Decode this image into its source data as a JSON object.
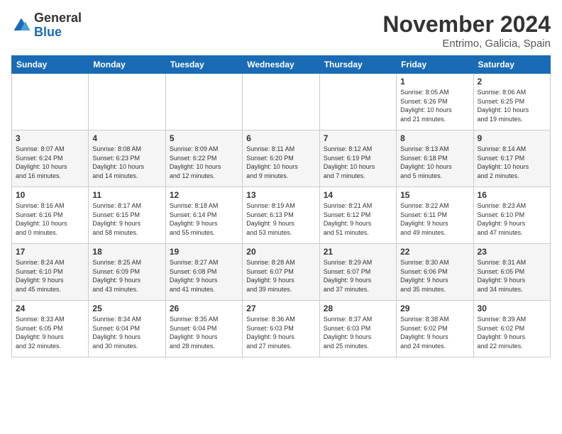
{
  "header": {
    "logo_general": "General",
    "logo_blue": "Blue",
    "month_title": "November 2024",
    "location": "Entrimo, Galicia, Spain"
  },
  "weekdays": [
    "Sunday",
    "Monday",
    "Tuesday",
    "Wednesday",
    "Thursday",
    "Friday",
    "Saturday"
  ],
  "weeks": [
    [
      {
        "day": "",
        "info": ""
      },
      {
        "day": "",
        "info": ""
      },
      {
        "day": "",
        "info": ""
      },
      {
        "day": "",
        "info": ""
      },
      {
        "day": "",
        "info": ""
      },
      {
        "day": "1",
        "info": "Sunrise: 8:05 AM\nSunset: 6:26 PM\nDaylight: 10 hours\nand 21 minutes."
      },
      {
        "day": "2",
        "info": "Sunrise: 8:06 AM\nSunset: 6:25 PM\nDaylight: 10 hours\nand 19 minutes."
      }
    ],
    [
      {
        "day": "3",
        "info": "Sunrise: 8:07 AM\nSunset: 6:24 PM\nDaylight: 10 hours\nand 16 minutes."
      },
      {
        "day": "4",
        "info": "Sunrise: 8:08 AM\nSunset: 6:23 PM\nDaylight: 10 hours\nand 14 minutes."
      },
      {
        "day": "5",
        "info": "Sunrise: 8:09 AM\nSunset: 6:22 PM\nDaylight: 10 hours\nand 12 minutes."
      },
      {
        "day": "6",
        "info": "Sunrise: 8:11 AM\nSunset: 6:20 PM\nDaylight: 10 hours\nand 9 minutes."
      },
      {
        "day": "7",
        "info": "Sunrise: 8:12 AM\nSunset: 6:19 PM\nDaylight: 10 hours\nand 7 minutes."
      },
      {
        "day": "8",
        "info": "Sunrise: 8:13 AM\nSunset: 6:18 PM\nDaylight: 10 hours\nand 5 minutes."
      },
      {
        "day": "9",
        "info": "Sunrise: 8:14 AM\nSunset: 6:17 PM\nDaylight: 10 hours\nand 2 minutes."
      }
    ],
    [
      {
        "day": "10",
        "info": "Sunrise: 8:16 AM\nSunset: 6:16 PM\nDaylight: 10 hours\nand 0 minutes."
      },
      {
        "day": "11",
        "info": "Sunrise: 8:17 AM\nSunset: 6:15 PM\nDaylight: 9 hours\nand 58 minutes."
      },
      {
        "day": "12",
        "info": "Sunrise: 8:18 AM\nSunset: 6:14 PM\nDaylight: 9 hours\nand 55 minutes."
      },
      {
        "day": "13",
        "info": "Sunrise: 8:19 AM\nSunset: 6:13 PM\nDaylight: 9 hours\nand 53 minutes."
      },
      {
        "day": "14",
        "info": "Sunrise: 8:21 AM\nSunset: 6:12 PM\nDaylight: 9 hours\nand 51 minutes."
      },
      {
        "day": "15",
        "info": "Sunrise: 8:22 AM\nSunset: 6:11 PM\nDaylight: 9 hours\nand 49 minutes."
      },
      {
        "day": "16",
        "info": "Sunrise: 8:23 AM\nSunset: 6:10 PM\nDaylight: 9 hours\nand 47 minutes."
      }
    ],
    [
      {
        "day": "17",
        "info": "Sunrise: 8:24 AM\nSunset: 6:10 PM\nDaylight: 9 hours\nand 45 minutes."
      },
      {
        "day": "18",
        "info": "Sunrise: 8:25 AM\nSunset: 6:09 PM\nDaylight: 9 hours\nand 43 minutes."
      },
      {
        "day": "19",
        "info": "Sunrise: 8:27 AM\nSunset: 6:08 PM\nDaylight: 9 hours\nand 41 minutes."
      },
      {
        "day": "20",
        "info": "Sunrise: 8:28 AM\nSunset: 6:07 PM\nDaylight: 9 hours\nand 39 minutes."
      },
      {
        "day": "21",
        "info": "Sunrise: 8:29 AM\nSunset: 6:07 PM\nDaylight: 9 hours\nand 37 minutes."
      },
      {
        "day": "22",
        "info": "Sunrise: 8:30 AM\nSunset: 6:06 PM\nDaylight: 9 hours\nand 35 minutes."
      },
      {
        "day": "23",
        "info": "Sunrise: 8:31 AM\nSunset: 6:05 PM\nDaylight: 9 hours\nand 34 minutes."
      }
    ],
    [
      {
        "day": "24",
        "info": "Sunrise: 8:33 AM\nSunset: 6:05 PM\nDaylight: 9 hours\nand 32 minutes."
      },
      {
        "day": "25",
        "info": "Sunrise: 8:34 AM\nSunset: 6:04 PM\nDaylight: 9 hours\nand 30 minutes."
      },
      {
        "day": "26",
        "info": "Sunrise: 8:35 AM\nSunset: 6:04 PM\nDaylight: 9 hours\nand 28 minutes."
      },
      {
        "day": "27",
        "info": "Sunrise: 8:36 AM\nSunset: 6:03 PM\nDaylight: 9 hours\nand 27 minutes."
      },
      {
        "day": "28",
        "info": "Sunrise: 8:37 AM\nSunset: 6:03 PM\nDaylight: 9 hours\nand 25 minutes."
      },
      {
        "day": "29",
        "info": "Sunrise: 8:38 AM\nSunset: 6:02 PM\nDaylight: 9 hours\nand 24 minutes."
      },
      {
        "day": "30",
        "info": "Sunrise: 8:39 AM\nSunset: 6:02 PM\nDaylight: 9 hours\nand 22 minutes."
      }
    ]
  ]
}
